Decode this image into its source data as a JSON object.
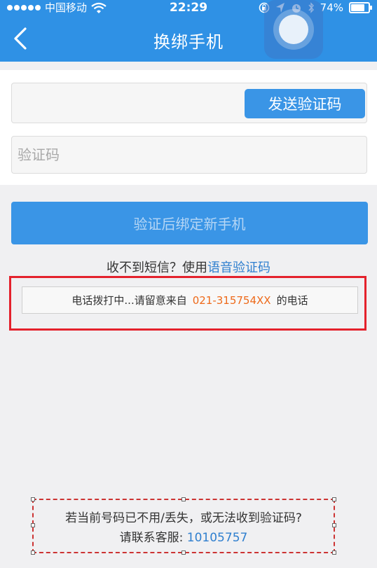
{
  "status_bar": {
    "carrier": "中国移动",
    "time": "22:29",
    "battery": "74%",
    "battery_level": 0.74
  },
  "nav": {
    "title": "换绑手机",
    "back_icon": "chevron-left-icon",
    "floating_icon": "assistive-touch-icon"
  },
  "form": {
    "phone_value": "",
    "send_code_label": "发送验证码",
    "code_placeholder": "验证码",
    "verify_button_label": "验证后绑定新手机"
  },
  "help": {
    "no_sms_prefix": "收不到短信？使用",
    "voice_code_link": "语音验证码",
    "calling_prefix": "电话拨打中...请留意来自",
    "calling_number": "021-315754XX",
    "calling_suffix": "的电话"
  },
  "footer": {
    "line1": "若当前号码已不用/丢失，或无法收到验证码?",
    "line2_prefix": "请联系客服: ",
    "service_phone": "10105757"
  },
  "colors": {
    "nav_blue": "#2f91e5",
    "button_blue": "#3a95e6",
    "link_blue": "#2f7fcf",
    "orange": "#ee6a1a",
    "highlight_red": "#e4212c"
  }
}
